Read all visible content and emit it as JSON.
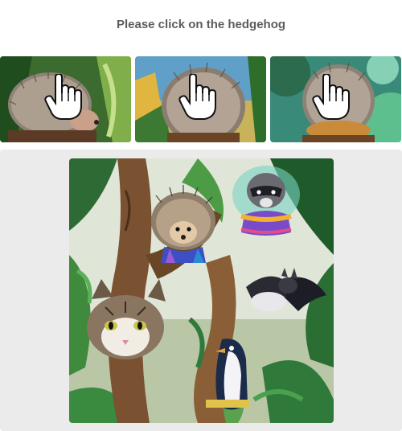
{
  "prompt": {
    "text": "Please click on the hedgehog"
  },
  "examples": [
    {
      "subject": "hedgehog",
      "icon": "pointer-hand-icon"
    },
    {
      "subject": "hedgehog",
      "icon": "pointer-hand-icon"
    },
    {
      "subject": "hedgehog",
      "icon": "pointer-hand-icon"
    }
  ],
  "puzzle": {
    "animals": [
      "hedgehog",
      "raccoon",
      "cat",
      "bat",
      "penguin"
    ]
  },
  "colors": {
    "prompt_text": "#5c5c5c",
    "board_bg": "#ebebeb",
    "jungle_green": "#2f7a3a",
    "sky": "#d9e8dc"
  }
}
